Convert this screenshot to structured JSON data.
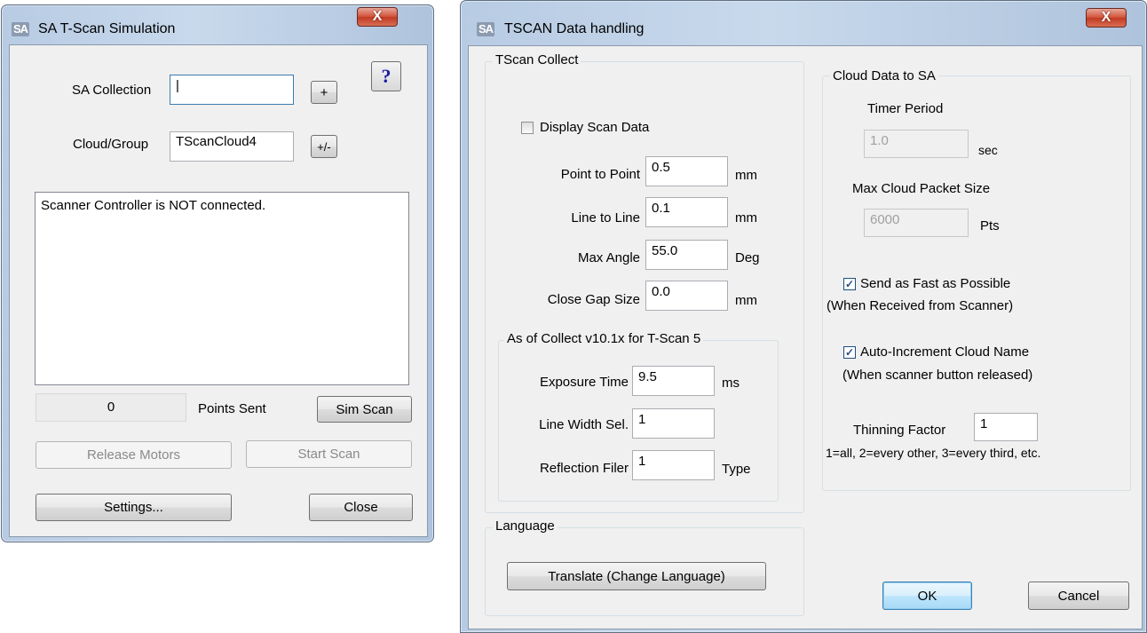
{
  "sim": {
    "title": "SA T-Scan Simulation",
    "logo": "SA",
    "close_glyph": "X",
    "help_glyph": "?",
    "sa_collection_label": "SA Collection",
    "sa_collection_value": "|",
    "plus_label": "+",
    "cloud_group_label": "Cloud/Group",
    "cloud_group_value": "TScanCloud4",
    "plusminus_label": "+/-",
    "status_text": "Scanner Controller is NOT connected.",
    "points_count": "0",
    "points_sent_label": "Points Sent",
    "sim_scan_label": "Sim Scan",
    "release_motors_label": "Release Motors",
    "start_scan_label": "Start Scan",
    "settings_label": "Settings...",
    "close_label": "Close"
  },
  "tscan": {
    "title": "TSCAN Data handling",
    "logo": "SA",
    "close_glyph": "X",
    "collect_group": "TScan Collect",
    "display_scan_label": "Display Scan Data",
    "display_scan_checked": false,
    "fields": [
      {
        "label": "Point to Point",
        "value": "0.5",
        "unit": "mm"
      },
      {
        "label": "Line to Line",
        "value": "0.1",
        "unit": "mm"
      },
      {
        "label": "Max Angle",
        "value": "55.0",
        "unit": "Deg"
      },
      {
        "label": "Close Gap Size",
        "value": "0.0",
        "unit": "mm"
      }
    ],
    "collect_v10_group": "As of Collect v10.1x for T-Scan 5",
    "v10_fields": [
      {
        "label": "Exposure Time",
        "value": "9.5",
        "unit": "ms"
      },
      {
        "label": "Line Width Sel.",
        "value": "1",
        "unit": ""
      },
      {
        "label": "Reflection Filer",
        "value": "1",
        "unit": "Type"
      }
    ],
    "language_group": "Language",
    "translate_label": "Translate (Change Language)",
    "cloud_group": "Cloud Data to SA",
    "timer_period_label": "Timer Period",
    "timer_period_value": "1.0",
    "timer_unit": "sec",
    "packet_size_label": "Max Cloud Packet Size",
    "packet_size_value": "6000",
    "packet_unit": "Pts",
    "send_fast_label": "Send as Fast as Possible",
    "send_fast_note": "(When Received from Scanner)",
    "send_fast_checked": true,
    "auto_inc_label": "Auto-Increment Cloud Name",
    "auto_inc_note": "(When scanner button released)",
    "auto_inc_checked": true,
    "thinning_label": "Thinning Factor",
    "thinning_value": "1",
    "thinning_note": "1=all, 2=every other, 3=every third, etc.",
    "check_glyph": "✓",
    "ok_label": "OK",
    "cancel_label": "Cancel"
  }
}
